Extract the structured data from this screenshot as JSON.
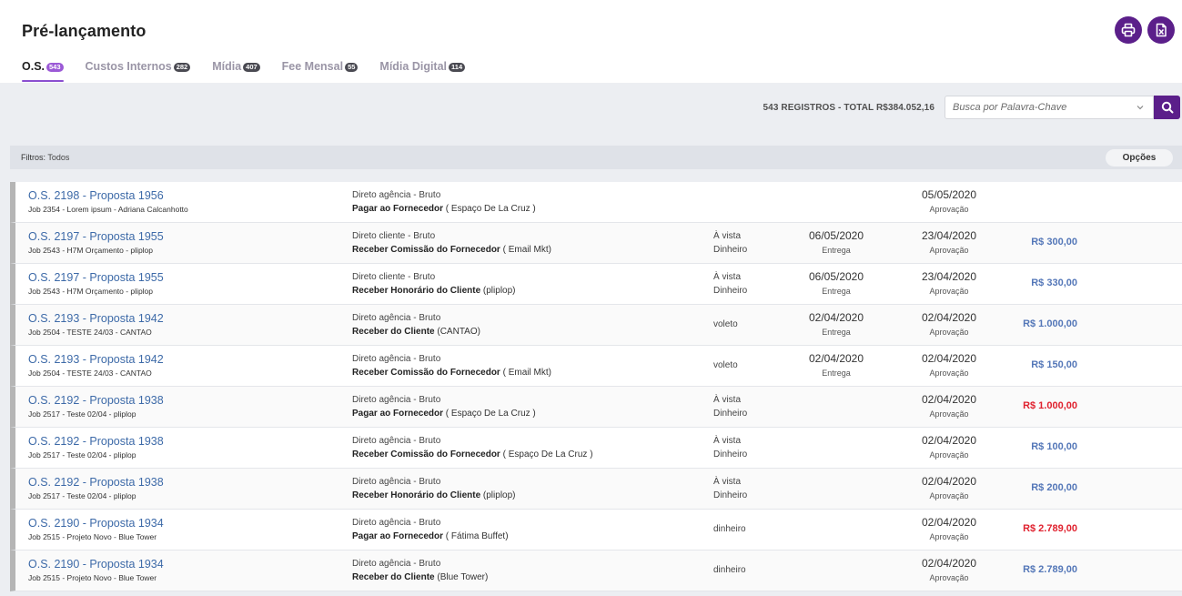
{
  "header": {
    "title": "Pré-lançamento",
    "print_icon": "printer-icon",
    "excel_icon": "excel-export-icon"
  },
  "tabs": [
    {
      "label": "O.S.",
      "count": "543",
      "active": true
    },
    {
      "label": "Custos Internos",
      "count": "282",
      "active": false
    },
    {
      "label": "Mídia",
      "count": "407",
      "active": false
    },
    {
      "label": "Fee Mensal",
      "count": "55",
      "active": false
    },
    {
      "label": "Mídia Digital",
      "count": "114",
      "active": false
    }
  ],
  "toolbar": {
    "totals": "543 REGISTROS - TOTAL R$384.052,16",
    "search_placeholder": "Busca por Palavra-Chave",
    "search_icon": "magnifier-icon"
  },
  "filters": {
    "label": "Filtros:",
    "value": "Todos",
    "options_label": "Opções"
  },
  "colors": {
    "accent": "#5b1f8a",
    "tab_badge_active": "#9b59d6",
    "link": "#3d6aa8",
    "value_positive": "#5477b8",
    "value_negative": "#e0222f"
  },
  "rows": [
    {
      "title": "O.S. 2198 - Proposta 1956",
      "job": "Job 2354 - Lorem ipsum - Adriana Calcanhotto",
      "type": "Direto agência - Bruto",
      "action_bold": "Pagar ao Fornecedor",
      "action_rest": " ( Espaço De La Cruz )",
      "pay1": "",
      "pay2": "",
      "date1": "",
      "date1_label": "",
      "date2": "05/05/2020",
      "date2_label": "Aprovação",
      "value": "",
      "negative": false
    },
    {
      "title": "O.S. 2197 - Proposta 1955",
      "job": "Job 2543 - H7M Orçamento - pliplop",
      "type": "Direto cliente - Bruto",
      "action_bold": "Receber Comissão do Fornecedor",
      "action_rest": " ( Email Mkt)",
      "pay1": "À vista",
      "pay2": "Dinheiro",
      "date1": "06/05/2020",
      "date1_label": "Entrega",
      "date2": "23/04/2020",
      "date2_label": "Aprovação",
      "value": "R$ 300,00",
      "negative": false
    },
    {
      "title": "O.S. 2197 - Proposta 1955",
      "job": "Job 2543 - H7M Orçamento - pliplop",
      "type": "Direto cliente - Bruto",
      "action_bold": "Receber Honorário do Cliente",
      "action_rest": " (pliplop)",
      "pay1": "À vista",
      "pay2": "Dinheiro",
      "date1": "06/05/2020",
      "date1_label": "Entrega",
      "date2": "23/04/2020",
      "date2_label": "Aprovação",
      "value": "R$ 330,00",
      "negative": false
    },
    {
      "title": "O.S. 2193 - Proposta 1942",
      "job": "Job 2504 - TESTE 24/03 - CANTAO",
      "type": "Direto agência - Bruto",
      "action_bold": "Receber do Cliente",
      "action_rest": " (CANTAO)",
      "pay1": "voleto",
      "pay2": "",
      "date1": "02/04/2020",
      "date1_label": "Entrega",
      "date2": "02/04/2020",
      "date2_label": "Aprovação",
      "value": "R$ 1.000,00",
      "negative": false
    },
    {
      "title": "O.S. 2193 - Proposta 1942",
      "job": "Job 2504 - TESTE 24/03 - CANTAO",
      "type": "Direto agência - Bruto",
      "action_bold": "Receber Comissão do Fornecedor",
      "action_rest": " ( Email Mkt)",
      "pay1": "voleto",
      "pay2": "",
      "date1": "02/04/2020",
      "date1_label": "Entrega",
      "date2": "02/04/2020",
      "date2_label": "Aprovação",
      "value": "R$ 150,00",
      "negative": false
    },
    {
      "title": "O.S. 2192 - Proposta 1938",
      "job": "Job 2517 - Teste 02/04 - pliplop",
      "type": "Direto agência - Bruto",
      "action_bold": "Pagar ao Fornecedor",
      "action_rest": " ( Espaço De La Cruz )",
      "pay1": "À vista",
      "pay2": "Dinheiro",
      "date1": "",
      "date1_label": "",
      "date2": "02/04/2020",
      "date2_label": "Aprovação",
      "value": "R$ 1.000,00",
      "negative": true
    },
    {
      "title": "O.S. 2192 - Proposta 1938",
      "job": "Job 2517 - Teste 02/04 - pliplop",
      "type": "Direto agência - Bruto",
      "action_bold": "Receber Comissão do Fornecedor",
      "action_rest": " ( Espaço De La Cruz )",
      "pay1": "À vista",
      "pay2": "Dinheiro",
      "date1": "",
      "date1_label": "",
      "date2": "02/04/2020",
      "date2_label": "Aprovação",
      "value": "R$ 100,00",
      "negative": false
    },
    {
      "title": "O.S. 2192 - Proposta 1938",
      "job": "Job 2517 - Teste 02/04 - pliplop",
      "type": "Direto agência - Bruto",
      "action_bold": "Receber Honorário do Cliente",
      "action_rest": " (pliplop)",
      "pay1": "À vista",
      "pay2": "Dinheiro",
      "date1": "",
      "date1_label": "",
      "date2": "02/04/2020",
      "date2_label": "Aprovação",
      "value": "R$ 200,00",
      "negative": false
    },
    {
      "title": "O.S. 2190 - Proposta 1934",
      "job": "Job 2515 - Projeto Novo - Blue Tower",
      "type": "Direto agência - Bruto",
      "action_bold": "Pagar ao Fornecedor",
      "action_rest": " ( Fátima Buffet)",
      "pay1": "dinheiro",
      "pay2": "",
      "date1": "",
      "date1_label": "",
      "date2": "02/04/2020",
      "date2_label": "Aprovação",
      "value": "R$ 2.789,00",
      "negative": true
    },
    {
      "title": "O.S. 2190 - Proposta 1934",
      "job": "Job 2515 - Projeto Novo - Blue Tower",
      "type": "Direto agência - Bruto",
      "action_bold": "Receber do Cliente",
      "action_rest": " (Blue Tower)",
      "pay1": "dinheiro",
      "pay2": "",
      "date1": "",
      "date1_label": "",
      "date2": "02/04/2020",
      "date2_label": "Aprovação",
      "value": "R$ 2.789,00",
      "negative": false
    }
  ]
}
